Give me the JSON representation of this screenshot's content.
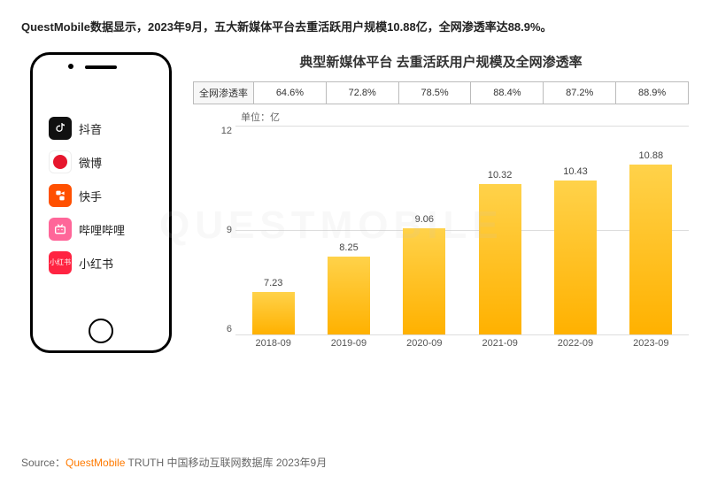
{
  "headline": "QuestMobile数据显示，2023年9月，五大新媒体平台去重活跃用户规模10.88亿，全网渗透率达88.9%。",
  "phone": {
    "apps": [
      {
        "name": "douyin",
        "label": "抖音"
      },
      {
        "name": "weibo",
        "label": "微博"
      },
      {
        "name": "kuaishou",
        "label": "快手"
      },
      {
        "name": "bilibili",
        "label": "哔哩哔哩"
      },
      {
        "name": "xiaohongshu",
        "label": "小红书"
      }
    ]
  },
  "chart": {
    "title": "典型新媒体平台 去重活跃用户规模及全网渗透率",
    "rate_label": "全网渗透率",
    "unit_label": "单位：亿"
  },
  "chart_data": {
    "type": "bar",
    "title": "典型新媒体平台 去重活跃用户规模及全网渗透率",
    "xlabel": "",
    "ylabel": "亿",
    "ylim": [
      6,
      12
    ],
    "yticks": [
      6,
      9,
      12
    ],
    "categories": [
      "2018-09",
      "2019-09",
      "2020-09",
      "2021-09",
      "2022-09",
      "2023-09"
    ],
    "values": [
      7.23,
      8.25,
      9.06,
      10.32,
      10.43,
      10.88
    ],
    "penetration_rate": [
      "64.6%",
      "72.8%",
      "78.5%",
      "88.4%",
      "87.2%",
      "88.9%"
    ]
  },
  "source": {
    "prefix": "Source：",
    "brand": "QuestMobile",
    "rest": " TRUTH 中国移动互联网数据库 2023年9月"
  },
  "watermark": "QUESTMOBILE"
}
